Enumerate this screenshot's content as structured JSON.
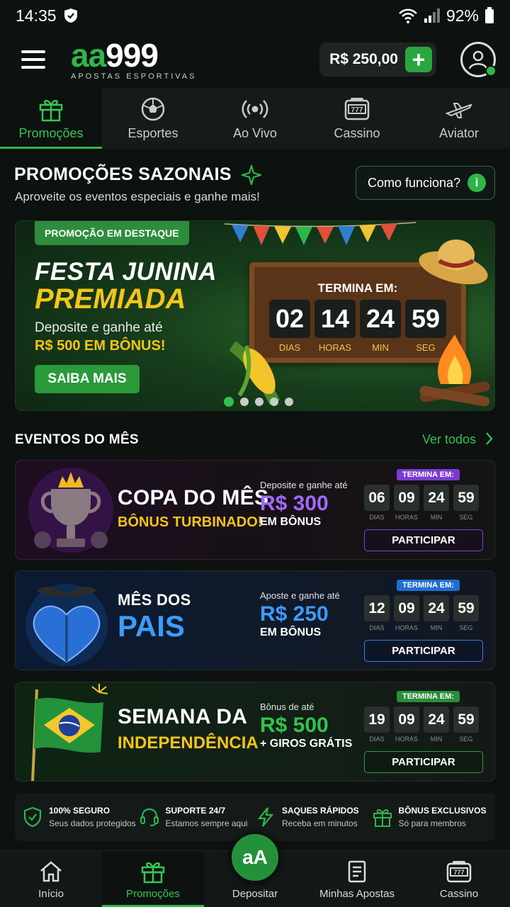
{
  "status_bar": {
    "time": "14:35",
    "battery": "92%"
  },
  "header": {
    "logo": "aa999",
    "logo_sub": "APOSTAS ESPORTIVAS",
    "balance": "R$ 250,00",
    "deposit_plus": "+"
  },
  "categories": [
    {
      "label": "Promoções",
      "icon": "gift-icon"
    },
    {
      "label": "Esportes",
      "icon": "soccer-ball-icon"
    },
    {
      "label": "Ao Vivo",
      "icon": "live-broadcast-icon"
    },
    {
      "label": "Cassino",
      "icon": "slot-machine-icon"
    },
    {
      "label": "Aviator",
      "icon": "airplane-icon"
    }
  ],
  "section": {
    "title": "PROMOÇÕES SAZONAIS",
    "subtitle": "Aproveite os eventos especiais e ganhe mais!",
    "how_button": "Como funciona?",
    "info_glyph": "i"
  },
  "hero": {
    "badge": "PROMOÇÃO EM DESTAQUE",
    "title_line1": "FESTA JUNINA",
    "title_line2": "PREMIADA",
    "desc": "Deposite e ganhe até",
    "bonus": "R$ 500 EM BÔNUS!",
    "cta": "SAIBA MAIS",
    "ends_label": "TERMINA EM:",
    "countdown": [
      {
        "value": "02",
        "unit": "DIAS"
      },
      {
        "value": "14",
        "unit": "HORAS"
      },
      {
        "value": "24",
        "unit": "MIN"
      },
      {
        "value": "59",
        "unit": "SEG"
      }
    ],
    "slides_total": 5,
    "slide_active": 1
  },
  "events": {
    "title": "EVENTOS DO MÊS",
    "see_all": "Ver todos",
    "items": [
      {
        "name1": "COPA DO MÊS",
        "name2": "BÔNUS TURBINADO!",
        "deal_small": "Deposite e ganhe até",
        "deal_value": "R$ 300",
        "deal_bottom": "EM BÔNUS",
        "ends": "TERMINA EM:",
        "countdown": [
          {
            "value": "06",
            "unit": "DIAS"
          },
          {
            "value": "09",
            "unit": "HORAS"
          },
          {
            "value": "24",
            "unit": "MIN"
          },
          {
            "value": "59",
            "unit": "SEG"
          }
        ],
        "cta": "PARTICIPAR",
        "accent": "#7a3bd1"
      },
      {
        "name1": "MÊS DOS",
        "name2": "PAIS",
        "deal_small": "Aposte e ganhe até",
        "deal_value": "R$ 250",
        "deal_bottom": "EM BÔNUS",
        "ends": "TERMINA EM:",
        "countdown": [
          {
            "value": "12",
            "unit": "DIAS"
          },
          {
            "value": "09",
            "unit": "HORAS"
          },
          {
            "value": "24",
            "unit": "MIN"
          },
          {
            "value": "59",
            "unit": "SEG"
          }
        ],
        "cta": "PARTICIPAR",
        "accent": "#1f6fd1"
      },
      {
        "name1": "SEMANA DA",
        "name2": "INDEPENDÊNCIA",
        "deal_small": "Bônus de até",
        "deal_value": "R$ 500",
        "deal_bottom": "+ GIROS GRÁTIS",
        "ends": "TERMINA EM:",
        "countdown": [
          {
            "value": "19",
            "unit": "DIAS"
          },
          {
            "value": "09",
            "unit": "HORAS"
          },
          {
            "value": "24",
            "unit": "MIN"
          },
          {
            "value": "59",
            "unit": "SEG"
          }
        ],
        "cta": "PARTICIPAR",
        "accent": "#2a8d3a"
      }
    ]
  },
  "trust": [
    {
      "title": "100% SEGURO",
      "desc": "Seus dados protegidos",
      "icon": "shield-check-icon"
    },
    {
      "title": "SUPORTE 24/7",
      "desc": "Estamos sempre aqui",
      "icon": "headset-icon"
    },
    {
      "title": "SAQUES RÁPIDOS",
      "desc": "Receba em minutos",
      "icon": "lightning-icon"
    },
    {
      "title": "BÔNUS EXCLUSIVOS",
      "desc": "Só para membros",
      "icon": "gift-icon"
    }
  ],
  "bottom_nav": [
    {
      "label": "Início",
      "icon": "home-icon"
    },
    {
      "label": "Promoções",
      "icon": "gift-icon"
    },
    {
      "label": "Depositar",
      "icon": "deposit-logo-icon"
    },
    {
      "label": "Minhas Apostas",
      "icon": "betslip-icon"
    },
    {
      "label": "Cassino",
      "icon": "slot-machine-icon"
    }
  ],
  "deposit_fab": "aA",
  "colors": {
    "brand_green": "#2fb54a",
    "accent_yellow": "#f6c518",
    "purple": "#a268ff",
    "blue": "#3d9bff"
  }
}
